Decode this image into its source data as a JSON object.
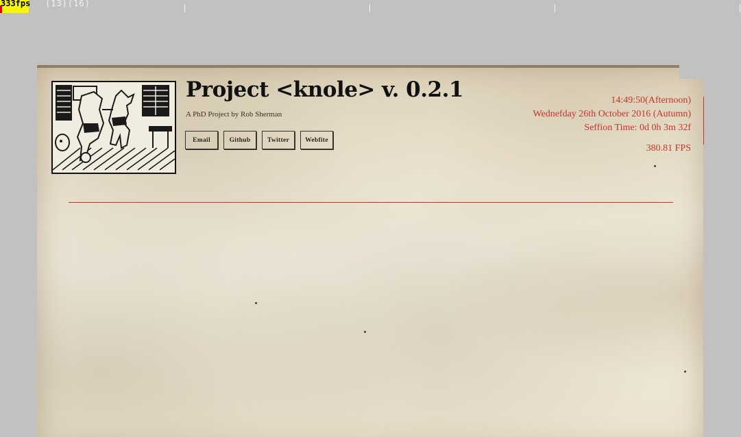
{
  "debug": {
    "fps": "333fps",
    "counts": "(13)(16)"
  },
  "header": {
    "title": "Project <knole> v. 0.2.1",
    "subtitle": "A PhD Project by Rob Sherman",
    "links": [
      {
        "label": "Email"
      },
      {
        "label": "Github"
      },
      {
        "label": "Twitter"
      },
      {
        "label": "Webfite"
      }
    ]
  },
  "status": {
    "time": "14:49:50(Afternoon)",
    "date": "Wednefday 26th October 2016 (Autumn)",
    "session": "Seffion Time: 0d 0h 3m 32f",
    "fps": "380.81 FPS"
  },
  "colors": {
    "background": "#c1c1c1",
    "parchment": "#ece4d1",
    "accent_red": "#c4352a",
    "ink": "#111111",
    "fps_bar": "#f8f700"
  },
  "icons": {
    "logo": "woodcut-illustration-icon"
  }
}
